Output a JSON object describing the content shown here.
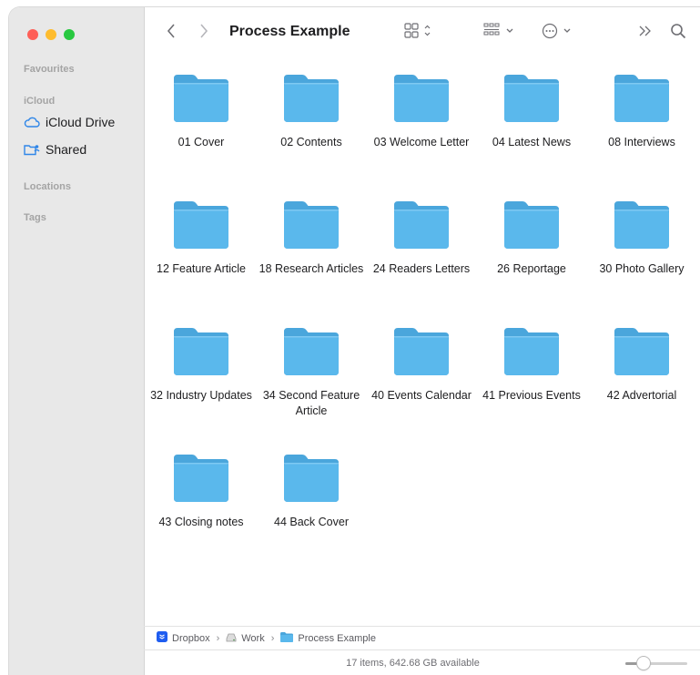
{
  "window": {
    "title": "Process Example"
  },
  "sidebar": {
    "sections": {
      "favourites": "Favourites",
      "icloud": "iCloud",
      "locations": "Locations",
      "tags": "Tags"
    },
    "items": [
      {
        "label": "iCloud Drive",
        "icon": "cloud-icon"
      },
      {
        "label": "Shared",
        "icon": "shared-folder-icon"
      }
    ]
  },
  "toolbar": {
    "back_icon": "chevron-left-icon",
    "forward_icon": "chevron-right-icon",
    "view_icon": "grid-view-icon",
    "group_icon": "group-icon",
    "action_icon": "ellipsis-icon",
    "more_icon": "double-chevron-icon",
    "search_icon": "search-icon"
  },
  "folders": [
    {
      "label": "01 Cover"
    },
    {
      "label": "02 Contents"
    },
    {
      "label": "03 Welcome Letter"
    },
    {
      "label": "04 Latest News"
    },
    {
      "label": "08 Interviews"
    },
    {
      "label": "12 Feature Article"
    },
    {
      "label": "18 Research Articles"
    },
    {
      "label": "24 Readers Letters"
    },
    {
      "label": "26 Reportage"
    },
    {
      "label": "30 Photo Gallery"
    },
    {
      "label": "32 Industry Updates"
    },
    {
      "label": "34 Second Feature Article"
    },
    {
      "label": "40 Events Calendar"
    },
    {
      "label": "41 Previous Events"
    },
    {
      "label": "42 Advertorial"
    },
    {
      "label": "43 Closing notes"
    },
    {
      "label": "44 Back Cover"
    }
  ],
  "pathbar": {
    "items": [
      "Dropbox",
      "Work",
      "Process Example"
    ]
  },
  "statusbar": {
    "text": "17 items, 642.68 GB available",
    "icon_size_level": 0.3
  },
  "colors": {
    "folder": "#5ab8ec",
    "folder_tab": "#4aa6dc",
    "sidebar_bg": "#e8e8e8",
    "dropbox": "#1f5df0"
  }
}
